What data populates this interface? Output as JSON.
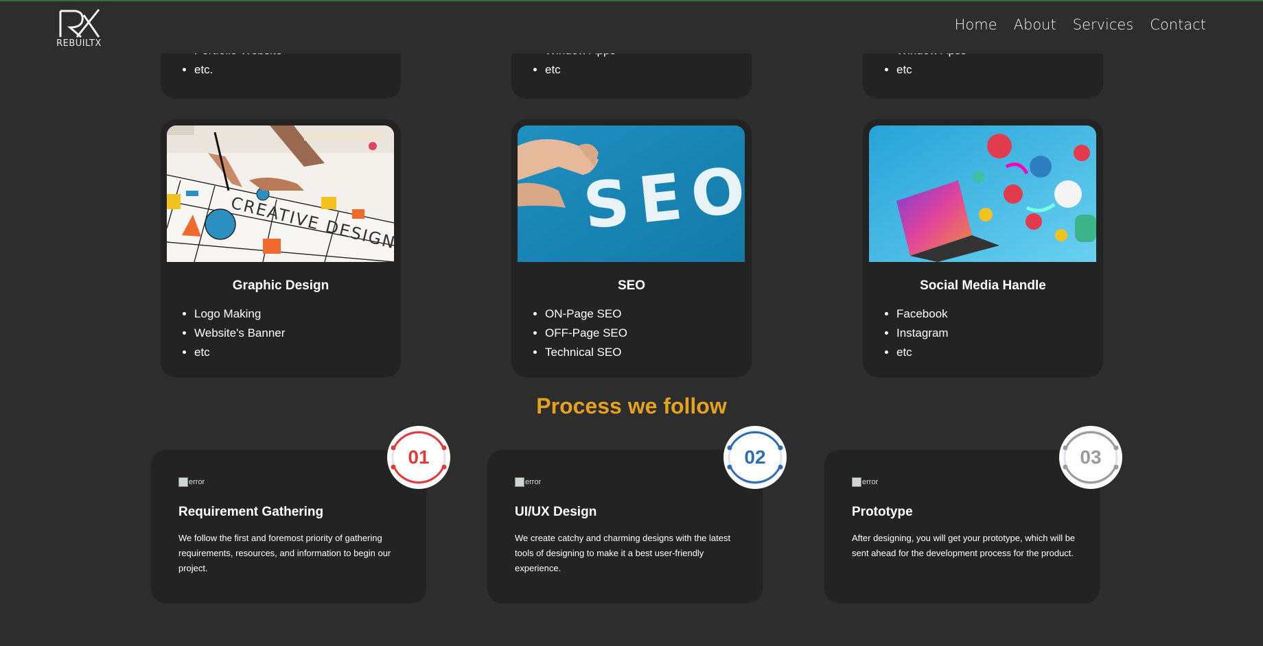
{
  "header": {
    "logo_text": "REBUILTX",
    "nav": [
      "Home",
      "About",
      "Services",
      "Contact"
    ]
  },
  "services_top": [
    {
      "items": [
        "Portfolio Website",
        "etc."
      ]
    },
    {
      "items": [
        "Window Apps",
        "etc"
      ]
    },
    {
      "items": [
        "Window Apss",
        "etc"
      ]
    }
  ],
  "services": [
    {
      "title": "Graphic Design",
      "image": "creative-design-photo",
      "image_text": "CREATIVE DESIGN",
      "items": [
        "Logo Making",
        "Website's Banner",
        "etc"
      ]
    },
    {
      "title": "SEO",
      "image": "seo-letters-photo",
      "image_text": "SEO",
      "items": [
        "ON-Page SEO",
        "OFF-Page SEO",
        "Technical SEO"
      ]
    },
    {
      "title": "Social Media Handle",
      "image": "social-media-laptop-photo",
      "items": [
        "Facebook",
        "Instagram",
        "etc"
      ]
    }
  ],
  "process": {
    "title": "Process we follow",
    "steps": [
      {
        "number": "01",
        "color": "#e03a3a",
        "alt": "error",
        "title": "Requirement Gathering",
        "text": "We follow the first and foremost priority of gathering requirements, resources, and information to begin our project."
      },
      {
        "number": "02",
        "color": "#2e6db4",
        "alt": "error",
        "title": "UI/UX Design",
        "text": "We create catchy and charming designs with the latest tools of designing to make it a best user-friendly experience."
      },
      {
        "number": "03",
        "color": "#9a9a9a",
        "alt": "error",
        "title": "Prototype",
        "text": "After designing, you will get your prototype, which will be sent ahead for the development process for the product."
      }
    ]
  },
  "colors": {
    "background": "#2d2d2d",
    "card": "#232323",
    "accent": "#e6a21a"
  }
}
